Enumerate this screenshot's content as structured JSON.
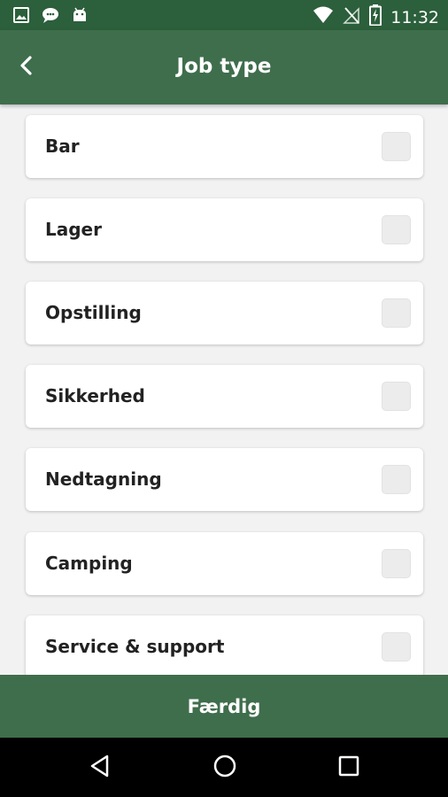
{
  "status_bar": {
    "time": "11:32",
    "left_icons": [
      "image-icon",
      "chat-icon",
      "android-icon"
    ],
    "right_icons": [
      "wifi-icon",
      "no-signal-icon",
      "battery-charging-icon"
    ]
  },
  "header": {
    "title": "Job type",
    "back_icon": "chevron-left-icon"
  },
  "job_types": [
    {
      "label": "Bar",
      "checked": false
    },
    {
      "label": "Lager",
      "checked": false
    },
    {
      "label": "Opstilling",
      "checked": false
    },
    {
      "label": "Sikkerhed",
      "checked": false
    },
    {
      "label": "Nedtagning",
      "checked": false
    },
    {
      "label": "Camping",
      "checked": false
    },
    {
      "label": "Service & support",
      "checked": false
    }
  ],
  "footer": {
    "done_label": "Færdig"
  },
  "nav": {
    "icons": [
      "back-triangle-icon",
      "home-circle-icon",
      "recents-square-icon"
    ]
  },
  "colors": {
    "status_bar": "#2c5f3b",
    "app_bar": "#3f6e4c",
    "background": "#f2f2f2"
  }
}
